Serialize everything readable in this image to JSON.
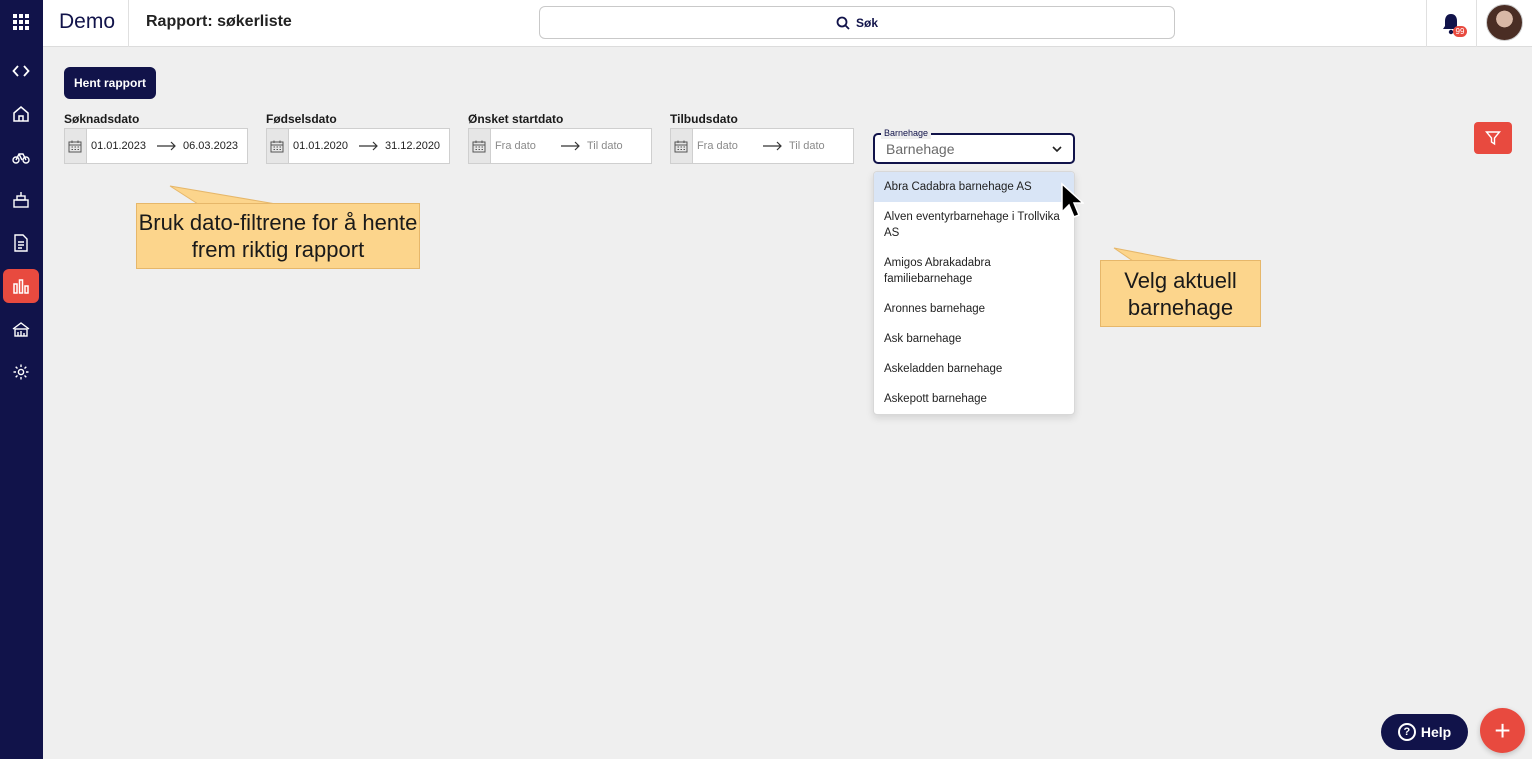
{
  "header": {
    "app_name": "Demo",
    "page_title": "Rapport: søkerliste",
    "search_label": "Søk",
    "notification_count": "99"
  },
  "sidebar": {
    "items": [
      {
        "icon": "grid-icon"
      },
      {
        "icon": "code-icon"
      },
      {
        "icon": "home-icon"
      },
      {
        "icon": "bicycle-icon"
      },
      {
        "icon": "building-icon"
      },
      {
        "icon": "document-icon"
      },
      {
        "icon": "chart-icon",
        "active": true
      },
      {
        "icon": "finance-icon"
      },
      {
        "icon": "gear-icon"
      }
    ],
    "active_color": "#e84a3f",
    "bg_color": "#11134a"
  },
  "toolbar": {
    "hent_label": "Hent rapport"
  },
  "filters": [
    {
      "label": "Søknadsdato",
      "from_value": "01.01.2023",
      "to_value": "06.03.2023",
      "from_placeholder": "",
      "to_placeholder": ""
    },
    {
      "label": "Fødselsdato",
      "from_value": "01.01.2020",
      "to_value": "31.12.2020",
      "from_placeholder": "",
      "to_placeholder": ""
    },
    {
      "label": "Ønsket startdato",
      "from_value": "",
      "to_value": "",
      "from_placeholder": "Fra dato",
      "to_placeholder": "Til dato"
    },
    {
      "label": "Tilbudsdato",
      "from_value": "",
      "to_value": "",
      "from_placeholder": "Fra dato",
      "to_placeholder": "Til dato"
    }
  ],
  "barnehage_select": {
    "legend": "Barnehage",
    "value": "Barnehage",
    "options": [
      "Abra Cadabra barnehage AS",
      "Alven eventyrbarnehage i Trollvika AS",
      "Amigos Abrakadabra familiebarnehage",
      "Aronnes barnehage",
      "Ask barnehage",
      "Askeladden barnehage",
      "Askepott barnehage"
    ],
    "highlighted_index": 0
  },
  "tooltips": {
    "date_tip": "Bruk dato-filtrene for å hente frem riktig rapport",
    "kindergarten_tip": "Velg aktuell barnehage"
  },
  "footer": {
    "help_label": "Help",
    "fab_label": "+"
  },
  "colors": {
    "brand": "#11134a",
    "accent": "#e84a3f",
    "tooltip": "#fcd58c"
  }
}
